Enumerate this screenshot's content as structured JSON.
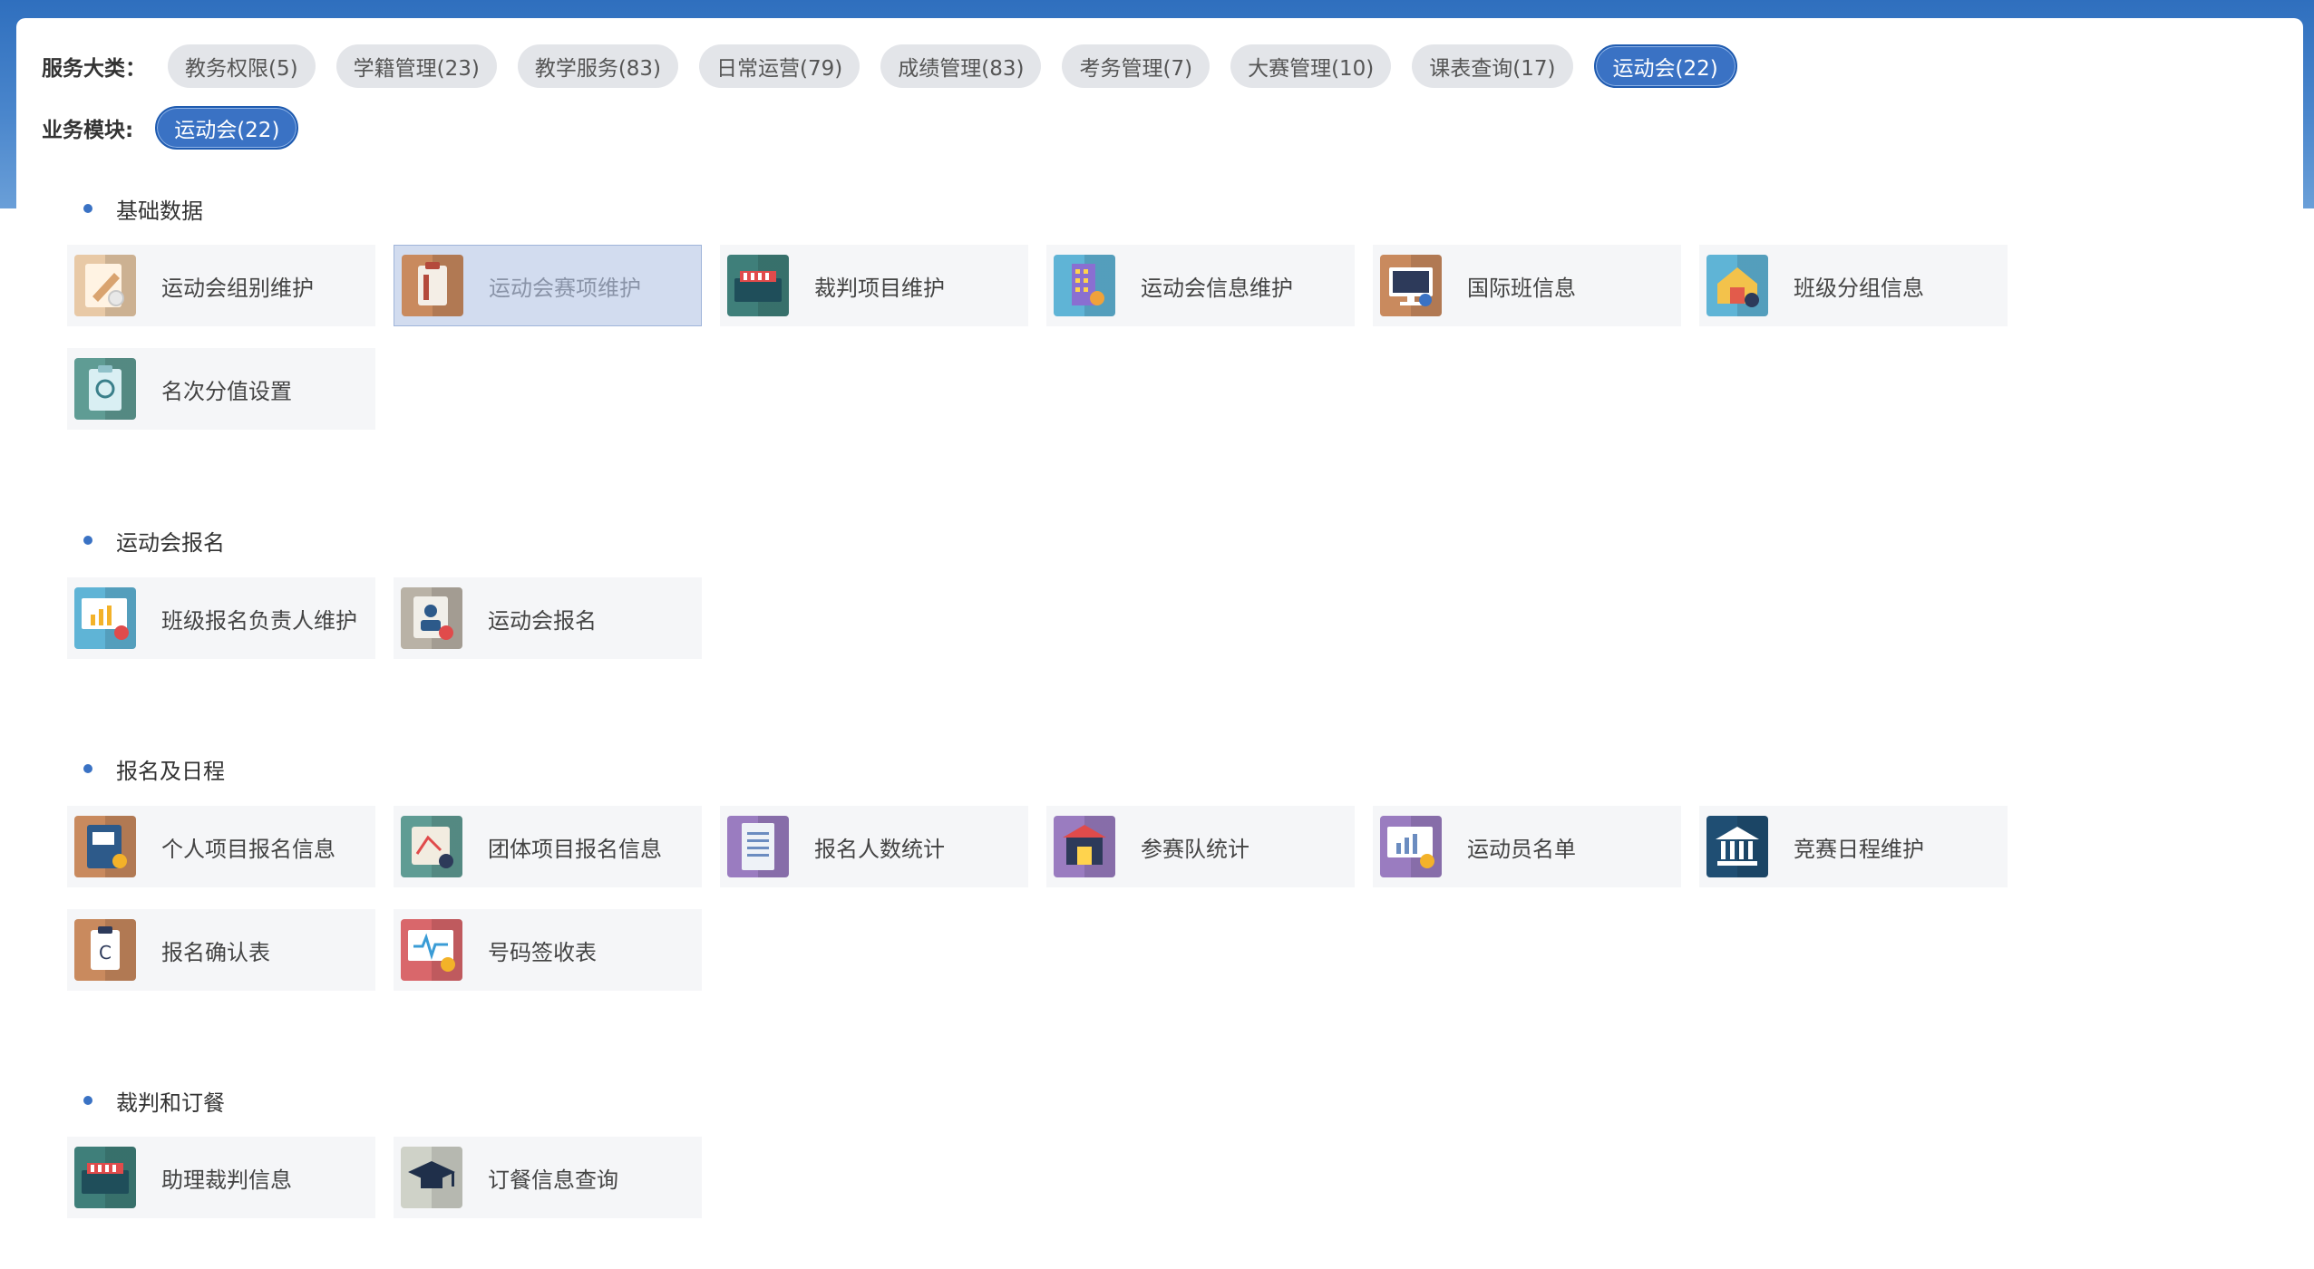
{
  "filters": {
    "category_label": "服务大类：",
    "categories": [
      {
        "label": "教务权限(5)"
      },
      {
        "label": "学籍管理(23)"
      },
      {
        "label": "教学服务(83)"
      },
      {
        "label": "日常运营(79)"
      },
      {
        "label": "成绩管理(83)"
      },
      {
        "label": "考务管理(7)"
      },
      {
        "label": "大赛管理(10)"
      },
      {
        "label": "课表查询(17)"
      },
      {
        "label": "运动会(22)"
      }
    ],
    "module_label": "业务模块:",
    "modules": [
      {
        "label": "运动会(22)"
      }
    ]
  },
  "sections": [
    {
      "title": "基础数据",
      "items": [
        {
          "label": "运动会组别维护",
          "icon": "pencil-gear-icon",
          "color": "#e8c9a6"
        },
        {
          "label": "运动会赛项维护",
          "icon": "clipboard-icon",
          "color": "#c98a5e"
        },
        {
          "label": "裁判项目维护",
          "icon": "toolbox-icon",
          "color": "#3f7f7a"
        },
        {
          "label": "运动会信息维护",
          "icon": "building-user-icon",
          "color": "#5fb4d6"
        },
        {
          "label": "国际班信息",
          "icon": "monitor-chart-icon",
          "color": "#c98a5e"
        },
        {
          "label": "班级分组信息",
          "icon": "house-lock-icon",
          "color": "#5fb4d6"
        },
        {
          "label": "名次分值设置",
          "icon": "clipboard-clock-icon",
          "color": "#5f9c94"
        }
      ]
    },
    {
      "title": "运动会报名",
      "items": [
        {
          "label": "班级报名负责人维护",
          "icon": "monitor-bars-icon",
          "color": "#5fb4d6"
        },
        {
          "label": "运动会报名",
          "icon": "user-badge-icon",
          "color": "#b9b2a6"
        }
      ]
    },
    {
      "title": "报名及日程",
      "items": [
        {
          "label": "个人项目报名信息",
          "icon": "notebook-icon",
          "color": "#c98a5e"
        },
        {
          "label": "团体项目报名信息",
          "icon": "map-tools-icon",
          "color": "#5f9c94"
        },
        {
          "label": "报名人数统计",
          "icon": "document-list-icon",
          "color": "#9a7cc0"
        },
        {
          "label": "参赛队统计",
          "icon": "store-icon",
          "color": "#9a7cc0"
        },
        {
          "label": "运动员名单",
          "icon": "monitor-user-icon",
          "color": "#9a7cc0"
        },
        {
          "label": "竞赛日程维护",
          "icon": "bank-icon",
          "color": "#1f4e73"
        },
        {
          "label": "报名确认表",
          "icon": "clipboard-c-icon",
          "color": "#c98a5e"
        },
        {
          "label": "号码签收表",
          "icon": "monitor-pulse-icon",
          "color": "#d9676b"
        }
      ]
    },
    {
      "title": "裁判和订餐",
      "items": [
        {
          "label": "助理裁判信息",
          "icon": "toolbox-icon",
          "color": "#3f7f7a"
        },
        {
          "label": "订餐信息查询",
          "icon": "graduation-cap-icon",
          "color": "#cfd2c8"
        }
      ]
    }
  ]
}
